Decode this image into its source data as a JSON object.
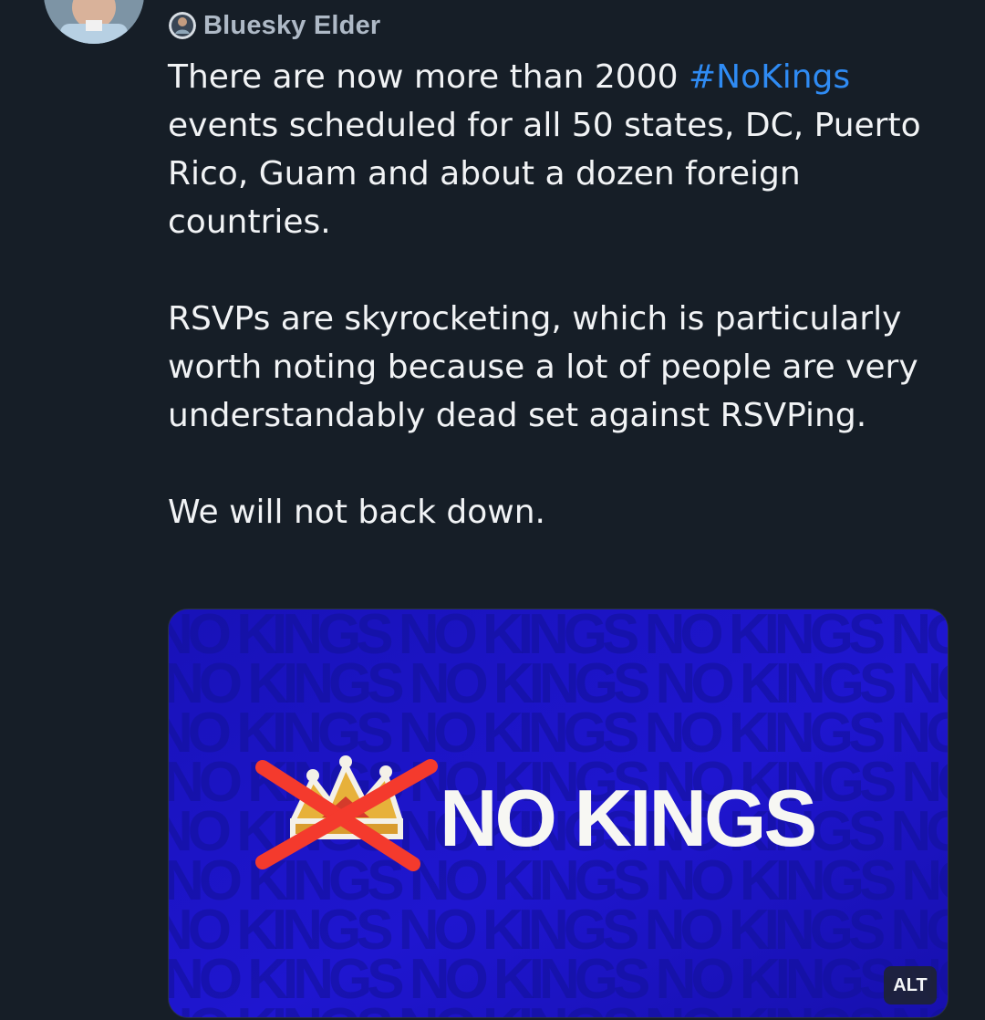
{
  "post": {
    "author_name": "Bluesky Elder",
    "paragraphs": [
      {
        "before": "There are now more than 2000 ",
        "hashtag": "#NoKings",
        "after": " events scheduled for all 50 states, DC, Puerto Rico, Guam and about a dozen foreign countries."
      },
      {
        "text": "RSVPs are skyrocketing, which is particularly worth noting because a lot of people are very understandably dead set against RSVPing."
      },
      {
        "text": "We will not back down."
      }
    ],
    "hashtag_color": "#2f8bf3"
  },
  "media": {
    "headline": "NO KINGS",
    "pattern_text": "NO KINGS",
    "background_color": "#1611c8",
    "alt_label": "ALT"
  },
  "icons": {
    "author_badge": "avatar-badge-icon",
    "crown": "crossed-crown-icon"
  }
}
